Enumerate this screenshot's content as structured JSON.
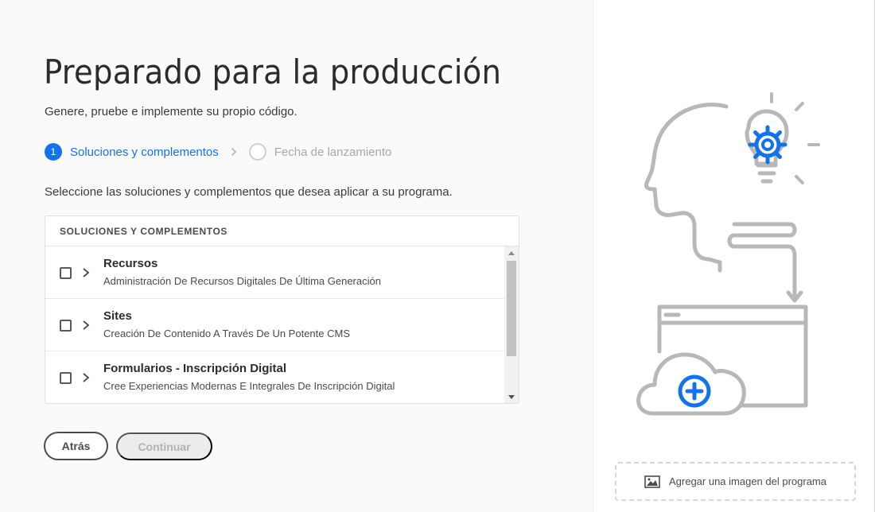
{
  "page": {
    "title": "Preparado para la producción",
    "subtitle": "Genere, pruebe e implemente su propio código.",
    "instruction": "Seleccione las soluciones y complementos que desea aplicar a su programa."
  },
  "stepper": {
    "steps": [
      {
        "number": "1",
        "label": "Soluciones y complementos",
        "state": "active"
      },
      {
        "number": "",
        "label": "Fecha de lanzamiento",
        "state": "inactive"
      }
    ]
  },
  "table": {
    "header": "SOLUCIONES Y COMPLEMENTOS",
    "rows": [
      {
        "name": "Recursos",
        "description": "Administración De Recursos Digitales De Última Generación",
        "checked": false
      },
      {
        "name": "Sites",
        "description": "Creación De Contenido A Través De Un Potente CMS",
        "checked": false
      },
      {
        "name": "Formularios - Inscripción Digital",
        "description": "Cree Experiencias Modernas E Integrales De Inscripción Digital",
        "checked": false
      }
    ]
  },
  "buttons": {
    "back": "Atrás",
    "continue": "Continuar"
  },
  "side": {
    "add_image": "Agregar una imagen del programa"
  },
  "colors": {
    "accent": "#1473e6",
    "illustration_line": "#b8b8b8"
  }
}
